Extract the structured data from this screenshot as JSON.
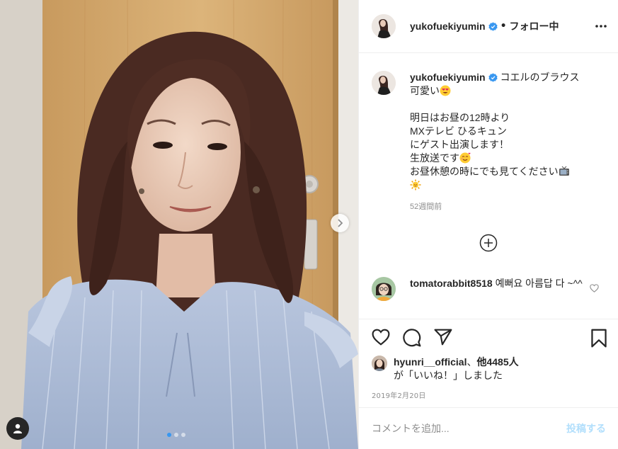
{
  "post": {
    "image_description_icon": "user-tag-icon",
    "carousel": {
      "current": 1,
      "total": 3
    }
  },
  "header": {
    "username": "yukofuekiyumin",
    "separator": "•",
    "follow_status": "フォロー中"
  },
  "caption": {
    "username": "yukofuekiyumin",
    "lines": [
      "コエルのブラウス",
      "可愛い",
      "",
      "明日はお昼の12時より",
      "MXテレビ ひるキュン",
      "にゲスト出演します！",
      "生放送です",
      "お昼休憩の時にでも見てください",
      ""
    ],
    "time": "52週間前"
  },
  "comment": {
    "username": "tomatorabbit8518",
    "text_line1": "예뻐요 아름답",
    "text_line2": "다 ~^^"
  },
  "likes": {
    "username": "hyunri__official",
    "suffix": "、",
    "others": "他4485人",
    "line2": "が「いいね！」しました"
  },
  "date": "2019年2月20日",
  "add_comment": {
    "placeholder": "コメントを追加...",
    "post_label": "投稿する"
  },
  "colors": {
    "verified": "#3897f0",
    "post_button_disabled": "#b2dffc",
    "muted": "#8e8e8e"
  }
}
